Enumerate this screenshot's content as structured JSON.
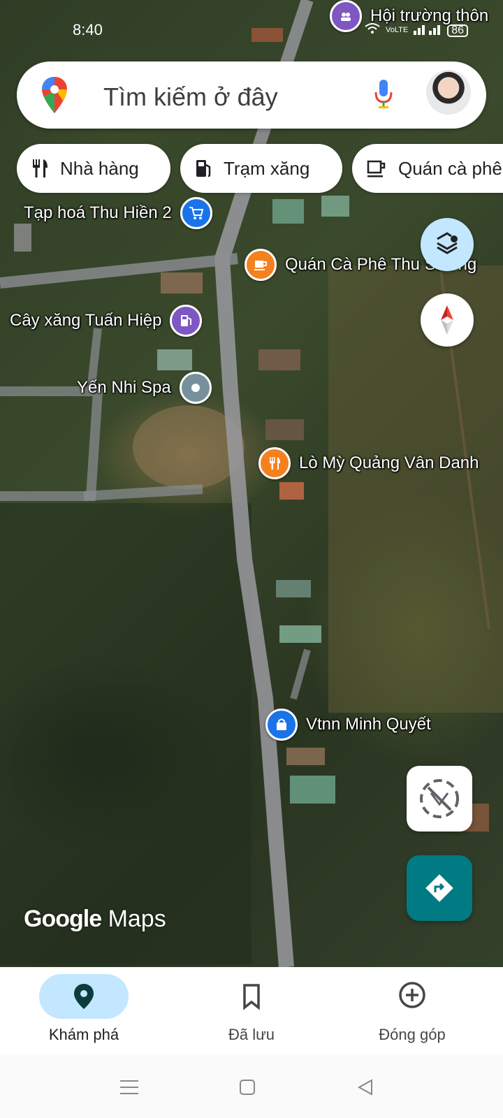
{
  "status_bar": {
    "time": "8:40",
    "battery": "86",
    "network_label": "VoLTE",
    "icons": [
      "wifi-icon",
      "signal-icon",
      "battery-icon"
    ]
  },
  "search": {
    "placeholder": "Tìm kiếm ở đây",
    "icons": [
      "maps-pin-logo",
      "mic-icon",
      "avatar"
    ]
  },
  "chips": [
    {
      "label": "Nhà hàng",
      "icon": "restaurant-icon"
    },
    {
      "label": "Trạm xăng",
      "icon": "gas-station-icon"
    },
    {
      "label": "Quán cà phê",
      "icon": "coffee-icon"
    }
  ],
  "places": {
    "top_label": "Hội trường thôn",
    "tap_hoa": "Tạp hoá Thu Hiền 2",
    "quan_ca_phe": "Quán Cà Phê Thu Sương",
    "cay_xang": "Cây xăng Tuấn Hiệp",
    "yen_nhi": "Yến Nhi Spa",
    "lo_my": "Lò Mỳ Quảng Vân Danh",
    "vtnn": "Vtnn Minh Quyết"
  },
  "branding": {
    "google": "Google",
    "maps": "Maps"
  },
  "bottom_nav": [
    {
      "label": "Khám phá",
      "icon": "explore-pin-icon",
      "selected": true
    },
    {
      "label": "Đã lưu",
      "icon": "bookmark-icon",
      "selected": false
    },
    {
      "label": "Đóng góp",
      "icon": "add-circle-icon",
      "selected": false
    }
  ],
  "colors": {
    "accent_teal": "#007b83",
    "selected_pill": "#c2e7ff",
    "poi_blue": "#1a73e8",
    "poi_orange": "#f4811f",
    "poi_purple": "#7e57c2",
    "poi_gray": "#78909c"
  }
}
